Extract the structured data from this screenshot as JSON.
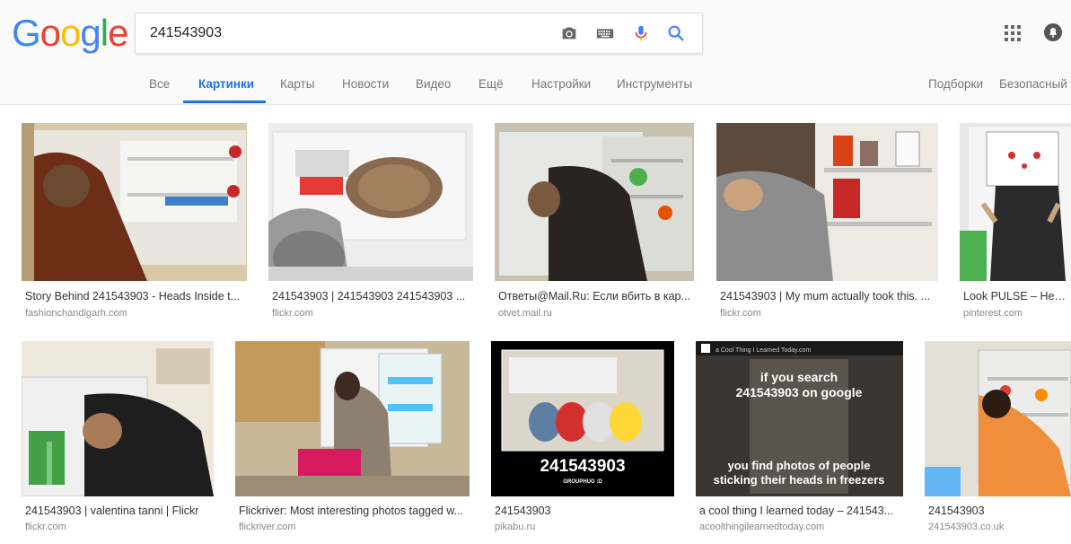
{
  "logo": {
    "letters": [
      "G",
      "o",
      "o",
      "g",
      "l",
      "e"
    ],
    "colors": [
      "#4285f4",
      "#ea4335",
      "#fbbc05",
      "#4285f4",
      "#34a853",
      "#ea4335"
    ]
  },
  "search": {
    "query": "241543903"
  },
  "icons": {
    "camera": "camera-icon",
    "keyboard": "keyboard-icon",
    "mic": "mic-icon",
    "search": "search-icon",
    "apps": "apps-grid-icon",
    "notifications": "bell-icon"
  },
  "tabs": [
    {
      "label": "Все"
    },
    {
      "label": "Картинки",
      "active": true
    },
    {
      "label": "Карты"
    },
    {
      "label": "Новости"
    },
    {
      "label": "Видео"
    },
    {
      "label": "Ещё"
    },
    {
      "label": "Настройки"
    },
    {
      "label": "Инструменты"
    }
  ],
  "right_links": {
    "collections": "Подборки",
    "safesearch": "Безопасный"
  },
  "accent_color": "#1a73e8",
  "results": [
    {
      "caption": "Story Behind 241543903 - Heads Inside t...",
      "source": "fashionchandigarh.com"
    },
    {
      "caption": "241543903 | 241543903 241543903 ...",
      "source": "flickr.com"
    },
    {
      "caption": "Ответы@Mail.Ru: Если вбить в кар...",
      "source": "otvet.mail.ru"
    },
    {
      "caption": "241543903 | My mum actually took this. ...",
      "source": "flickr.com"
    },
    {
      "caption": "Look PULSE – Head i",
      "source": "pinterest.com"
    },
    {
      "caption": "241543903 | valentina tanni | Flickr",
      "source": "flickr.com"
    },
    {
      "caption": "Flickriver: Most interesting photos tagged w...",
      "source": "flickriver.com"
    },
    {
      "caption": "241543903",
      "source": "pikabu.ru",
      "image_text": {
        "big": "241543903",
        "small": "GROUPHUG :D"
      }
    },
    {
      "caption": "a cool thing I learned today – 241543...",
      "source": "acoolthingilearnedtoday.com",
      "image_text": {
        "header": "a Cool Thing I Learned Today.com",
        "line1": "if you search",
        "line2": "241543903 on google",
        "line3": "you find photos of people",
        "line4": "sticking their heads in freezers"
      }
    },
    {
      "caption": "241543903",
      "source": "241543903.co.uk"
    }
  ]
}
